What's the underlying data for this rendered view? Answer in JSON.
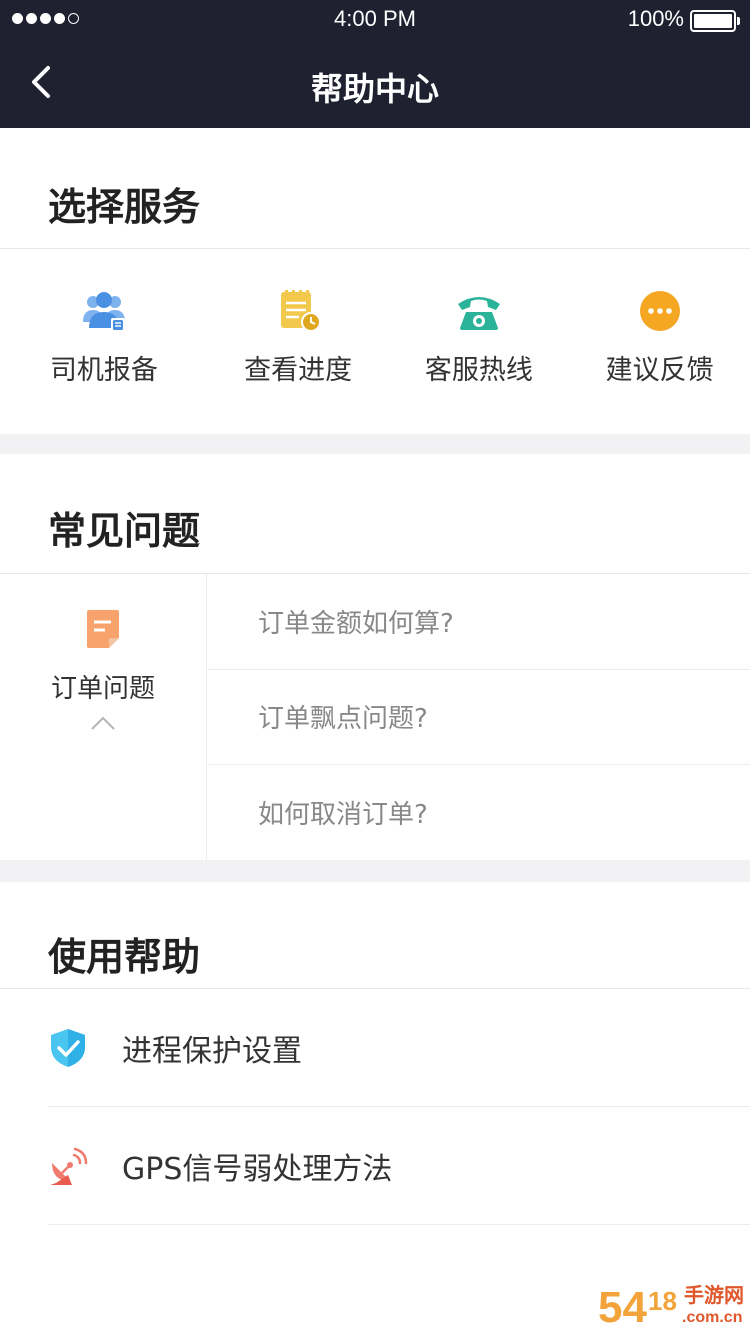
{
  "status_bar": {
    "time": "4:00 PM",
    "battery": "100%"
  },
  "nav": {
    "title": "帮助中心"
  },
  "select_service": {
    "title": "选择服务",
    "items": [
      {
        "label": "司机报备",
        "icon": "driver-report-icon",
        "color": "#4a90e2"
      },
      {
        "label": "查看进度",
        "icon": "progress-icon",
        "color": "#f2c94c"
      },
      {
        "label": "客服热线",
        "icon": "phone-icon",
        "color": "#2bb39a"
      },
      {
        "label": "建议反馈",
        "icon": "feedback-icon",
        "color": "#f5a623"
      }
    ]
  },
  "faq": {
    "title": "常见问题",
    "category": {
      "label": "订单问题",
      "icon": "order-document-icon",
      "color": "#f7a36b"
    },
    "questions": [
      "订单金额如何算?",
      "订单飘点问题?",
      "如何取消订单?"
    ]
  },
  "usage_help": {
    "title": "使用帮助",
    "items": [
      {
        "label": "进程保护设置",
        "icon": "shield-check-icon",
        "color": "#4ac5f0"
      },
      {
        "label": "GPS信号弱处理方法",
        "icon": "satellite-dish-icon",
        "color": "#f07a6e"
      }
    ]
  },
  "colors": {
    "header_bg": "#1f2030",
    "section_gap": "#f2f2f4"
  },
  "watermark": {
    "text": "54¹⁸ 手游网 .com.cn"
  }
}
